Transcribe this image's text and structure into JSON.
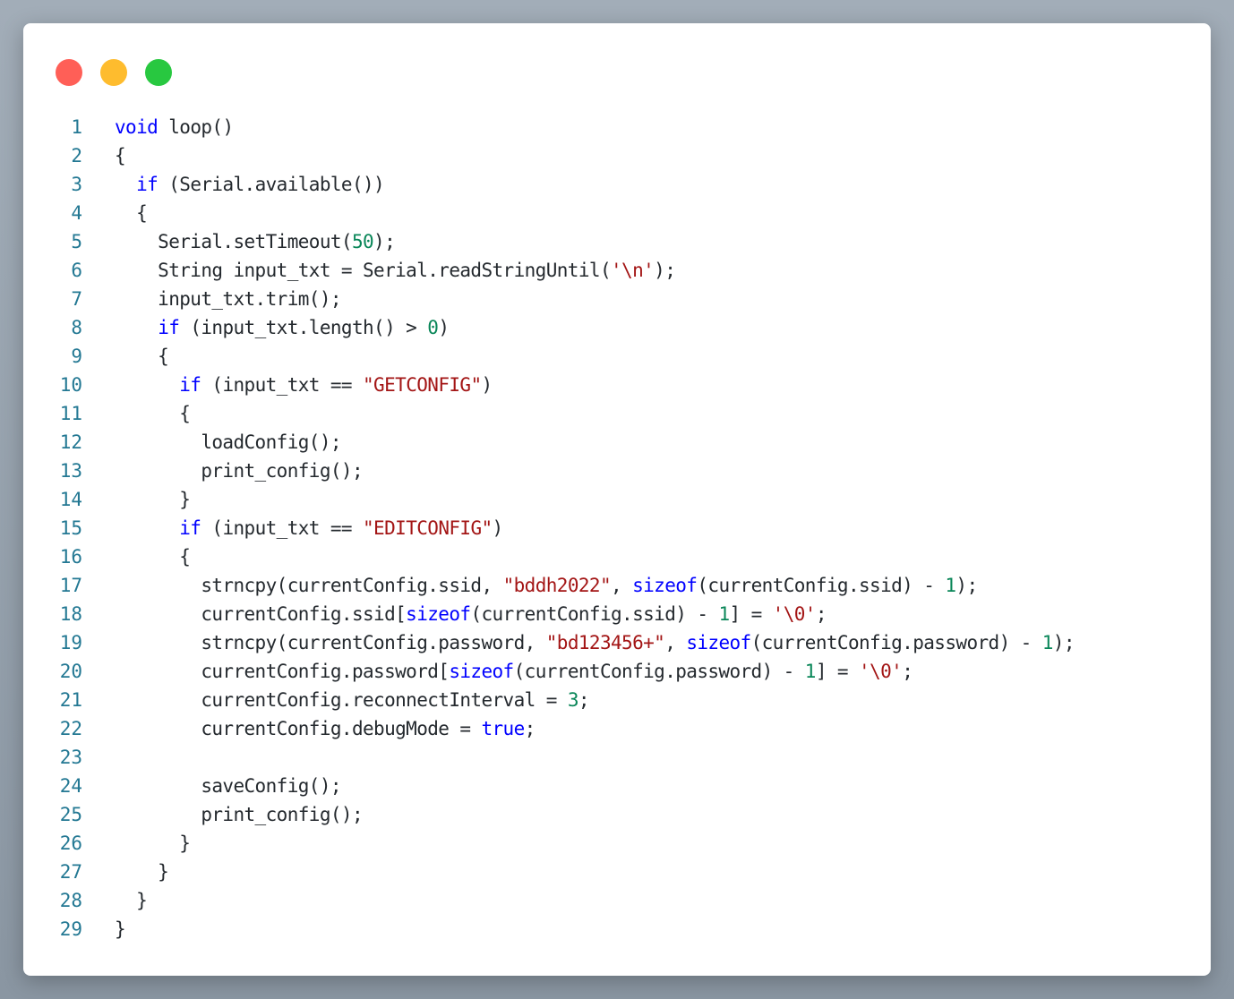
{
  "window": {
    "controls": [
      "close-icon",
      "minimize-icon",
      "maximize-icon"
    ],
    "colors": {
      "close": "#ff5f57",
      "minimize": "#febc2e",
      "maximize": "#28c840"
    }
  },
  "theme": {
    "keyword": "#0000ff",
    "number": "#098658",
    "string": "#a31515",
    "text": "#24292e",
    "line_number": "#237893"
  },
  "code": {
    "lines": [
      [
        [
          "kw",
          "void"
        ],
        [
          "p",
          " loop()"
        ]
      ],
      [
        [
          "p",
          "{"
        ]
      ],
      [
        [
          "p",
          "  "
        ],
        [
          "kw",
          "if"
        ],
        [
          "p",
          " (Serial.available())"
        ]
      ],
      [
        [
          "p",
          "  {"
        ]
      ],
      [
        [
          "p",
          "    Serial.setTimeout("
        ],
        [
          "num",
          "50"
        ],
        [
          "p",
          ");"
        ]
      ],
      [
        [
          "p",
          "    String input_txt = Serial.readStringUntil("
        ],
        [
          "str",
          "'\\n'"
        ],
        [
          "p",
          ");"
        ]
      ],
      [
        [
          "p",
          "    input_txt.trim();"
        ]
      ],
      [
        [
          "p",
          "    "
        ],
        [
          "kw",
          "if"
        ],
        [
          "p",
          " (input_txt.length() > "
        ],
        [
          "num",
          "0"
        ],
        [
          "p",
          ")"
        ]
      ],
      [
        [
          "p",
          "    {"
        ]
      ],
      [
        [
          "p",
          "      "
        ],
        [
          "kw",
          "if"
        ],
        [
          "p",
          " (input_txt == "
        ],
        [
          "str",
          "\"GETCONFIG\""
        ],
        [
          "p",
          ")"
        ]
      ],
      [
        [
          "p",
          "      {"
        ]
      ],
      [
        [
          "p",
          "        loadConfig();"
        ]
      ],
      [
        [
          "p",
          "        print_config();"
        ]
      ],
      [
        [
          "p",
          "      }"
        ]
      ],
      [
        [
          "p",
          "      "
        ],
        [
          "kw",
          "if"
        ],
        [
          "p",
          " (input_txt == "
        ],
        [
          "str",
          "\"EDITCONFIG\""
        ],
        [
          "p",
          ")"
        ]
      ],
      [
        [
          "p",
          "      {"
        ]
      ],
      [
        [
          "p",
          "        strncpy(currentConfig.ssid, "
        ],
        [
          "str",
          "\"bddh2022\""
        ],
        [
          "p",
          ", "
        ],
        [
          "kw",
          "sizeof"
        ],
        [
          "p",
          "(currentConfig.ssid) - "
        ],
        [
          "num",
          "1"
        ],
        [
          "p",
          ");"
        ]
      ],
      [
        [
          "p",
          "        currentConfig.ssid["
        ],
        [
          "kw",
          "sizeof"
        ],
        [
          "p",
          "(currentConfig.ssid) - "
        ],
        [
          "num",
          "1"
        ],
        [
          "p",
          "] = "
        ],
        [
          "str",
          "'\\0'"
        ],
        [
          "p",
          ";"
        ]
      ],
      [
        [
          "p",
          "        strncpy(currentConfig.password, "
        ],
        [
          "str",
          "\"bd123456+\""
        ],
        [
          "p",
          ", "
        ],
        [
          "kw",
          "sizeof"
        ],
        [
          "p",
          "(currentConfig.password) - "
        ],
        [
          "num",
          "1"
        ],
        [
          "p",
          ");"
        ]
      ],
      [
        [
          "p",
          "        currentConfig.password["
        ],
        [
          "kw",
          "sizeof"
        ],
        [
          "p",
          "(currentConfig.password) - "
        ],
        [
          "num",
          "1"
        ],
        [
          "p",
          "] = "
        ],
        [
          "str",
          "'\\0'"
        ],
        [
          "p",
          ";"
        ]
      ],
      [
        [
          "p",
          "        currentConfig.reconnectInterval = "
        ],
        [
          "num",
          "3"
        ],
        [
          "p",
          ";"
        ]
      ],
      [
        [
          "p",
          "        currentConfig.debugMode = "
        ],
        [
          "kw",
          "true"
        ],
        [
          "p",
          ";"
        ]
      ],
      [],
      [
        [
          "p",
          "        saveConfig();"
        ]
      ],
      [
        [
          "p",
          "        print_config();"
        ]
      ],
      [
        [
          "p",
          "      }"
        ]
      ],
      [
        [
          "p",
          "    }"
        ]
      ],
      [
        [
          "p",
          "  }"
        ]
      ],
      [
        [
          "p",
          "}"
        ]
      ]
    ]
  }
}
